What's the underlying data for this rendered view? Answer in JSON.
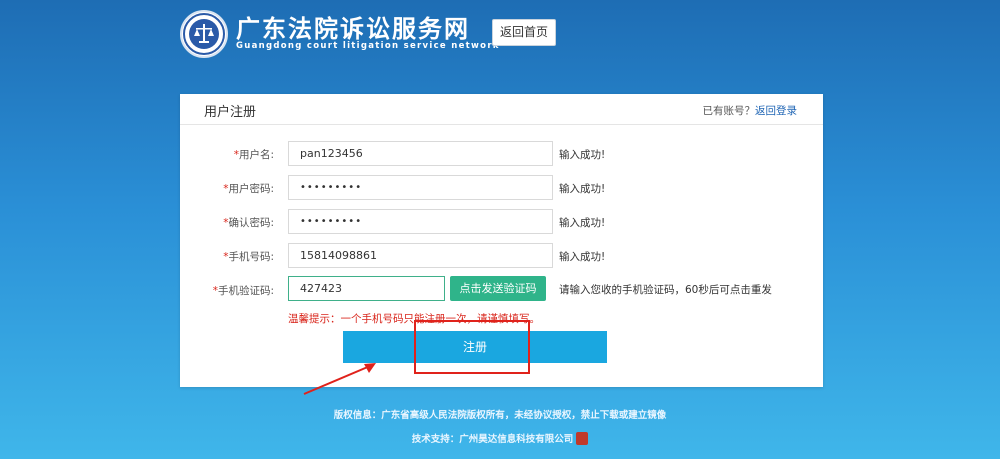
{
  "header": {
    "title": "广东法院诉讼服务网",
    "subtitle": "Guangdong court litigation service network",
    "home_button": "返回首页"
  },
  "card": {
    "title": "用户注册",
    "have_account": "已有账号？",
    "login_link": "返回登录"
  },
  "form": {
    "required_mark": "*",
    "fields": [
      {
        "label": "用户名:",
        "value": "pan123456",
        "status": "输入成功!"
      },
      {
        "label": "用户密码:",
        "value": "•••••••••",
        "status": "输入成功!"
      },
      {
        "label": "确认密码:",
        "value": "•••••••••",
        "status": "输入成功!"
      },
      {
        "label": "手机号码:",
        "value": "15814098861",
        "status": "输入成功!"
      },
      {
        "label": "手机验证码:",
        "value": "427423"
      }
    ],
    "sms_button": "点击发送验证码",
    "sms_hint": "请输入您收的手机验证码，60秒后可点击重发",
    "tip": "温馨提示：一个手机号码只能注册一次，请谨慎填写。",
    "register_button": "注册"
  },
  "footer": {
    "copyright": "版权信息：广东省高级人民法院版权所有，未经协议授权，禁止下载或建立镜像",
    "support": "技术支持：广州昊达信息科技有限公司"
  },
  "colors": {
    "accent": "#1aa7e0",
    "sms_button": "#2fb48a",
    "annotation": "#e0221b"
  }
}
